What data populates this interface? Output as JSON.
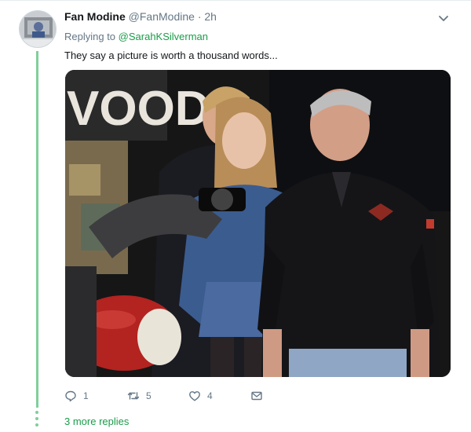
{
  "tweet": {
    "author": {
      "name": "Fan Modine",
      "handle": "@FanModine",
      "separator": "·",
      "time": "2h"
    },
    "replying_prefix": "Replying to ",
    "replying_to": "@SarahKSilverman",
    "text": "They say a picture is worth a thousand words...",
    "media": {
      "description": "photo",
      "sign_text": "VOOD"
    },
    "actions": {
      "reply_count": "1",
      "retweet_count": "5",
      "like_count": "4"
    },
    "more_replies": "3 more replies"
  },
  "colors": {
    "accent": "#1b9c4a",
    "thread_line": "#7fcf9a",
    "muted": "#657786",
    "text": "#14171a"
  },
  "icons": {
    "menu": "chevron-down-icon",
    "reply": "reply-icon",
    "retweet": "retweet-icon",
    "like": "heart-icon",
    "dm": "envelope-icon"
  }
}
